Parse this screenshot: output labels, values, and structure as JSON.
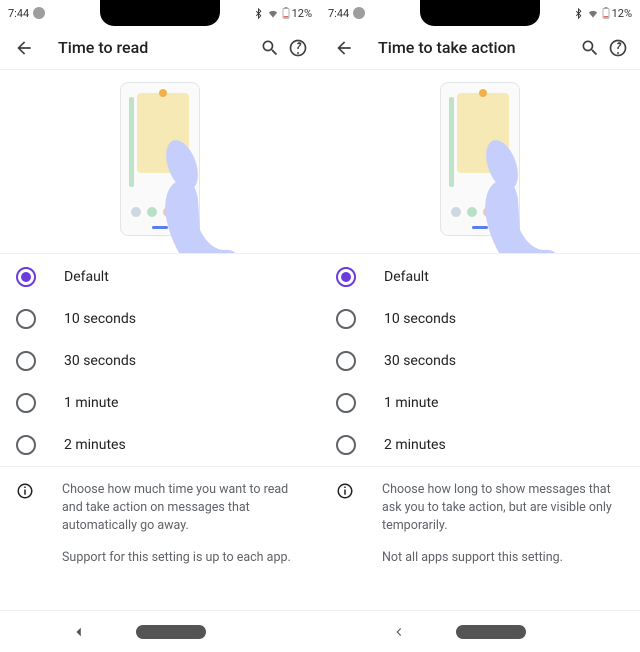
{
  "status": {
    "time": "7:44",
    "battery": "12%"
  },
  "screens": {
    "0": {
      "title": "Time to read",
      "options": {
        "0": "Default",
        "1": "10 seconds",
        "2": "30 seconds",
        "3": "1 minute",
        "4": "2 minutes"
      },
      "desc": "Choose how much time you want to read and take action on messages that automatically go away.",
      "sub": "Support for this setting is up to each app."
    },
    "1": {
      "title": "Time to take action",
      "options": {
        "0": "Default",
        "1": "10 seconds",
        "2": "30 seconds",
        "3": "1 minute",
        "4": "2 minutes"
      },
      "desc": "Choose how long to show messages that ask you to take action, but are visible only temporarily.",
      "sub": "Not all apps support this setting."
    }
  },
  "selected_index": 0
}
